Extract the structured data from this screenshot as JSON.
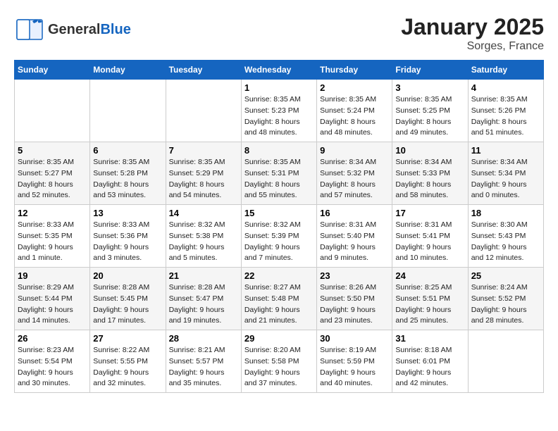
{
  "header": {
    "logo_general": "General",
    "logo_blue": "Blue",
    "month": "January 2025",
    "location": "Sorges, France"
  },
  "weekdays": [
    "Sunday",
    "Monday",
    "Tuesday",
    "Wednesday",
    "Thursday",
    "Friday",
    "Saturday"
  ],
  "weeks": [
    [
      {
        "day": "",
        "info": ""
      },
      {
        "day": "",
        "info": ""
      },
      {
        "day": "",
        "info": ""
      },
      {
        "day": "1",
        "info": "Sunrise: 8:35 AM\nSunset: 5:23 PM\nDaylight: 8 hours\nand 48 minutes."
      },
      {
        "day": "2",
        "info": "Sunrise: 8:35 AM\nSunset: 5:24 PM\nDaylight: 8 hours\nand 48 minutes."
      },
      {
        "day": "3",
        "info": "Sunrise: 8:35 AM\nSunset: 5:25 PM\nDaylight: 8 hours\nand 49 minutes."
      },
      {
        "day": "4",
        "info": "Sunrise: 8:35 AM\nSunset: 5:26 PM\nDaylight: 8 hours\nand 51 minutes."
      }
    ],
    [
      {
        "day": "5",
        "info": "Sunrise: 8:35 AM\nSunset: 5:27 PM\nDaylight: 8 hours\nand 52 minutes."
      },
      {
        "day": "6",
        "info": "Sunrise: 8:35 AM\nSunset: 5:28 PM\nDaylight: 8 hours\nand 53 minutes."
      },
      {
        "day": "7",
        "info": "Sunrise: 8:35 AM\nSunset: 5:29 PM\nDaylight: 8 hours\nand 54 minutes."
      },
      {
        "day": "8",
        "info": "Sunrise: 8:35 AM\nSunset: 5:31 PM\nDaylight: 8 hours\nand 55 minutes."
      },
      {
        "day": "9",
        "info": "Sunrise: 8:34 AM\nSunset: 5:32 PM\nDaylight: 8 hours\nand 57 minutes."
      },
      {
        "day": "10",
        "info": "Sunrise: 8:34 AM\nSunset: 5:33 PM\nDaylight: 8 hours\nand 58 minutes."
      },
      {
        "day": "11",
        "info": "Sunrise: 8:34 AM\nSunset: 5:34 PM\nDaylight: 9 hours\nand 0 minutes."
      }
    ],
    [
      {
        "day": "12",
        "info": "Sunrise: 8:33 AM\nSunset: 5:35 PM\nDaylight: 9 hours\nand 1 minute."
      },
      {
        "day": "13",
        "info": "Sunrise: 8:33 AM\nSunset: 5:36 PM\nDaylight: 9 hours\nand 3 minutes."
      },
      {
        "day": "14",
        "info": "Sunrise: 8:32 AM\nSunset: 5:38 PM\nDaylight: 9 hours\nand 5 minutes."
      },
      {
        "day": "15",
        "info": "Sunrise: 8:32 AM\nSunset: 5:39 PM\nDaylight: 9 hours\nand 7 minutes."
      },
      {
        "day": "16",
        "info": "Sunrise: 8:31 AM\nSunset: 5:40 PM\nDaylight: 9 hours\nand 9 minutes."
      },
      {
        "day": "17",
        "info": "Sunrise: 8:31 AM\nSunset: 5:41 PM\nDaylight: 9 hours\nand 10 minutes."
      },
      {
        "day": "18",
        "info": "Sunrise: 8:30 AM\nSunset: 5:43 PM\nDaylight: 9 hours\nand 12 minutes."
      }
    ],
    [
      {
        "day": "19",
        "info": "Sunrise: 8:29 AM\nSunset: 5:44 PM\nDaylight: 9 hours\nand 14 minutes."
      },
      {
        "day": "20",
        "info": "Sunrise: 8:28 AM\nSunset: 5:45 PM\nDaylight: 9 hours\nand 17 minutes."
      },
      {
        "day": "21",
        "info": "Sunrise: 8:28 AM\nSunset: 5:47 PM\nDaylight: 9 hours\nand 19 minutes."
      },
      {
        "day": "22",
        "info": "Sunrise: 8:27 AM\nSunset: 5:48 PM\nDaylight: 9 hours\nand 21 minutes."
      },
      {
        "day": "23",
        "info": "Sunrise: 8:26 AM\nSunset: 5:50 PM\nDaylight: 9 hours\nand 23 minutes."
      },
      {
        "day": "24",
        "info": "Sunrise: 8:25 AM\nSunset: 5:51 PM\nDaylight: 9 hours\nand 25 minutes."
      },
      {
        "day": "25",
        "info": "Sunrise: 8:24 AM\nSunset: 5:52 PM\nDaylight: 9 hours\nand 28 minutes."
      }
    ],
    [
      {
        "day": "26",
        "info": "Sunrise: 8:23 AM\nSunset: 5:54 PM\nDaylight: 9 hours\nand 30 minutes."
      },
      {
        "day": "27",
        "info": "Sunrise: 8:22 AM\nSunset: 5:55 PM\nDaylight: 9 hours\nand 32 minutes."
      },
      {
        "day": "28",
        "info": "Sunrise: 8:21 AM\nSunset: 5:57 PM\nDaylight: 9 hours\nand 35 minutes."
      },
      {
        "day": "29",
        "info": "Sunrise: 8:20 AM\nSunset: 5:58 PM\nDaylight: 9 hours\nand 37 minutes."
      },
      {
        "day": "30",
        "info": "Sunrise: 8:19 AM\nSunset: 5:59 PM\nDaylight: 9 hours\nand 40 minutes."
      },
      {
        "day": "31",
        "info": "Sunrise: 8:18 AM\nSunset: 6:01 PM\nDaylight: 9 hours\nand 42 minutes."
      },
      {
        "day": "",
        "info": ""
      }
    ]
  ]
}
